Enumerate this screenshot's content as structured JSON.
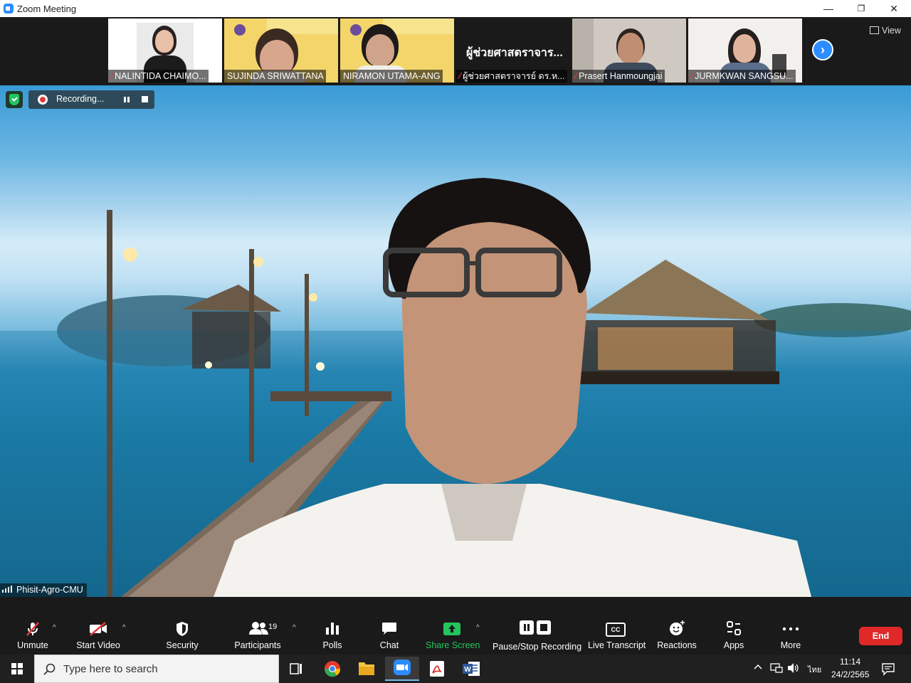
{
  "window": {
    "title": "Zoom Meeting",
    "minimize_glyph": "—",
    "restore_glyph": "❐",
    "close_glyph": "✕"
  },
  "gallery": {
    "participants": [
      {
        "name": "NALINTIDA CHAIMO...",
        "muted": true
      },
      {
        "name": "SUJINDA SRIWATTANA",
        "muted": false
      },
      {
        "name": "NIRAMON UTAMA-ANG",
        "muted": false
      },
      {
        "name": "ผู้ช่วยศาสตราจารย์ ดร.ห...",
        "title_text": "ผู้ช่วยศาสตราจาร...",
        "muted": true
      },
      {
        "name": "Prasert Hanmoungjai",
        "muted": true
      },
      {
        "name": "JURMKWAN SANGSU...",
        "muted": true
      }
    ],
    "next_icon": "chevron-right-icon",
    "view_label": "View"
  },
  "recording": {
    "label": "Recording..."
  },
  "main_video": {
    "speaker_name": "Phisit-Agro-CMU"
  },
  "toolbar": {
    "unmute": "Unmute",
    "start_video": "Start Video",
    "security": "Security",
    "participants": "Participants",
    "participants_count": "19",
    "polls": "Polls",
    "chat": "Chat",
    "share_screen": "Share Screen",
    "pause_stop_recording": "Pause/Stop Recording",
    "live_transcript": "Live Transcript",
    "live_transcript_icon_text": "CC",
    "reactions": "Reactions",
    "apps": "Apps",
    "more": "More",
    "end": "End",
    "caret_glyph": "^"
  },
  "taskbar": {
    "search_placeholder": "Type here to search",
    "time": "11:14",
    "date": "24/2/2565",
    "language": "ไทย"
  },
  "colors": {
    "accent_blue": "#2d8cff",
    "share_green": "#23c55e",
    "end_red": "#e02828",
    "muted_red": "#e5383b"
  }
}
